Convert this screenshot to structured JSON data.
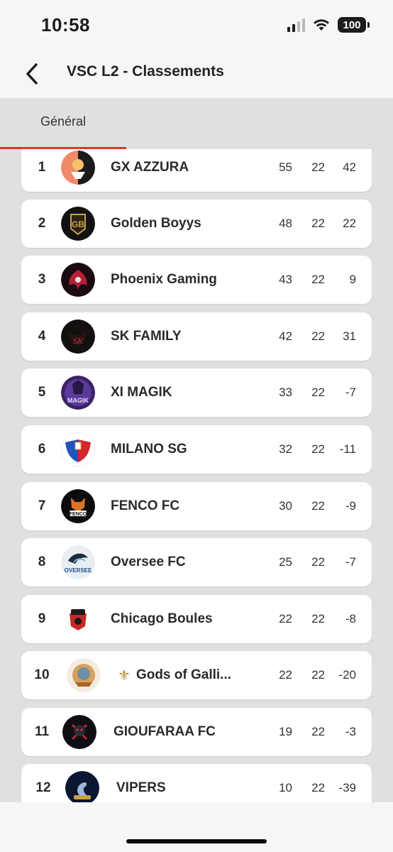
{
  "status": {
    "time": "10:58",
    "battery": "100"
  },
  "nav": {
    "title": "VSC L2 - Classements"
  },
  "tabs": [
    {
      "label": "Général"
    }
  ],
  "teams": [
    {
      "rank": "1",
      "name": "GX AZZURA",
      "pts": "55",
      "played": "22",
      "diff": "42",
      "logo": "gx-azzura-logo"
    },
    {
      "rank": "2",
      "name": "Golden Boyys",
      "pts": "48",
      "played": "22",
      "diff": "22",
      "logo": "golden-boyys-logo"
    },
    {
      "rank": "3",
      "name": "Phoenix Gaming",
      "pts": "43",
      "played": "22",
      "diff": "9",
      "logo": "phoenix-gaming-logo"
    },
    {
      "rank": "4",
      "name": "SK FAMILY",
      "pts": "42",
      "played": "22",
      "diff": "31",
      "logo": "sk-family-logo"
    },
    {
      "rank": "5",
      "name": "XI MAGIK",
      "pts": "33",
      "played": "22",
      "diff": "-7",
      "logo": "xi-magik-logo"
    },
    {
      "rank": "6",
      "name": "MILANO SG",
      "pts": "32",
      "played": "22",
      "diff": "-11",
      "logo": "milano-sg-logo"
    },
    {
      "rank": "7",
      "name": "FENCO FC",
      "pts": "30",
      "played": "22",
      "diff": "-9",
      "logo": "fenco-fc-logo"
    },
    {
      "rank": "8",
      "name": "Oversee FC",
      "pts": "25",
      "played": "22",
      "diff": "-7",
      "logo": "oversee-fc-logo"
    },
    {
      "rank": "9",
      "name": "Chicago Boules",
      "pts": "22",
      "played": "22",
      "diff": "-8",
      "logo": "chicago-boules-logo"
    },
    {
      "rank": "10",
      "name": "Gods of Galli...",
      "pts": "22",
      "played": "22",
      "diff": "-20",
      "logo": "gods-of-gallia-logo",
      "prefix_icon": "fleur-de-lis-icon"
    },
    {
      "rank": "11",
      "name": "GIOUFARAA FC",
      "pts": "19",
      "played": "22",
      "diff": "-3",
      "logo": "gioufaraa-fc-logo"
    },
    {
      "rank": "12",
      "name": "VIPERS",
      "pts": "10",
      "played": "22",
      "diff": "-39",
      "logo": "vipers-logo"
    }
  ],
  "colors": {
    "accent": "#d93a2b",
    "tab_bg": "#e0e0e0",
    "card_bg": "#ffffff"
  }
}
